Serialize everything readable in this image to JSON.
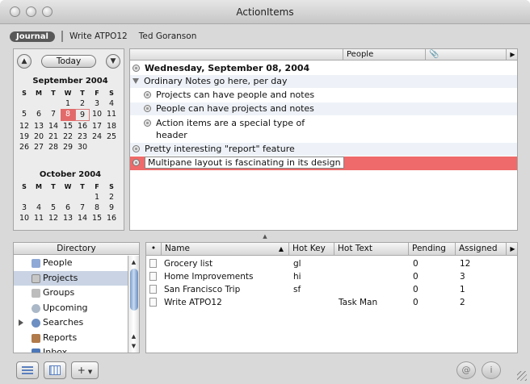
{
  "window": {
    "title": "ActionItems"
  },
  "breadcrumbs": {
    "active": "Journal",
    "items": [
      "Write ATPO12",
      "Ted Goranson"
    ]
  },
  "calendar": {
    "today_label": "Today",
    "prev_icon": "up-arrow-icon",
    "next_icon": "down-arrow-icon",
    "weekday_headers": [
      "S",
      "M",
      "T",
      "W",
      "T",
      "F",
      "S"
    ],
    "months": [
      {
        "title": "September 2004",
        "weeks": [
          [
            "",
            "",
            "",
            "1",
            "2",
            "3",
            "4"
          ],
          [
            "5",
            "6",
            "7",
            "8",
            "9",
            "10",
            "11"
          ],
          [
            "12",
            "13",
            "14",
            "15",
            "16",
            "17",
            "18"
          ],
          [
            "19",
            "20",
            "21",
            "22",
            "23",
            "24",
            "25"
          ],
          [
            "26",
            "27",
            "28",
            "29",
            "30",
            "",
            ""
          ]
        ],
        "selected_day": "8",
        "boxed_day": "9"
      },
      {
        "title": "October 2004",
        "weeks": [
          [
            "",
            "",
            "",
            "",
            "",
            "1",
            "2"
          ],
          [
            "3",
            "4",
            "5",
            "6",
            "7",
            "8",
            "9"
          ],
          [
            "10",
            "11",
            "12",
            "13",
            "14",
            "15",
            "16"
          ]
        ]
      }
    ]
  },
  "notes": {
    "columns": {
      "people": "People",
      "attachment_icon": "paperclip-icon"
    },
    "rows": [
      {
        "text": "Wednesday, September 08, 2004",
        "bold": true
      },
      {
        "text": "Ordinary Notes go here, per day"
      },
      {
        "text": "Projects can have people and notes"
      },
      {
        "text": "People can have projects and notes"
      },
      {
        "text": "Action items are a special type of"
      },
      {
        "text": "header"
      },
      {
        "text": "Pretty interesting \"report\" feature"
      },
      {
        "text": "Multipane layout is fascinating in its design"
      }
    ]
  },
  "directory": {
    "header": "Directory",
    "items": [
      {
        "label": "People",
        "icon": "people-icon"
      },
      {
        "label": "Projects",
        "icon": "projects-icon",
        "selected": true
      },
      {
        "label": "Groups",
        "icon": "groups-icon"
      },
      {
        "label": "Upcoming",
        "icon": "upcoming-icon"
      },
      {
        "label": "Searches",
        "icon": "search-icon"
      },
      {
        "label": "Reports",
        "icon": "reports-icon"
      },
      {
        "label": "Inbox",
        "icon": "inbox-icon"
      }
    ]
  },
  "projects_table": {
    "headers": {
      "bullet": "•",
      "name": "Name",
      "hotkey": "Hot Key",
      "hottext": "Hot Text",
      "pending": "Pending",
      "assigned": "Assigned"
    },
    "rows": [
      {
        "name": "Grocery list",
        "hotkey": "gl",
        "hottext": "",
        "pending": "0",
        "assigned": "12"
      },
      {
        "name": "Home Improvements",
        "hotkey": "hi",
        "hottext": "",
        "pending": "0",
        "assigned": "3"
      },
      {
        "name": "San Francisco Trip",
        "hotkey": "sf",
        "hottext": "",
        "pending": "0",
        "assigned": "1"
      },
      {
        "name": "Write ATPO12",
        "hotkey": "",
        "hottext": "Task Man",
        "pending": "0",
        "assigned": "2"
      }
    ]
  },
  "toolbar": {
    "add_label": "+",
    "at_label": "@",
    "info_label": "i"
  },
  "colors": {
    "highlight": "#ef6a6a",
    "selection": "#c9d3e3",
    "calendar_selected": "#e36a6a"
  }
}
